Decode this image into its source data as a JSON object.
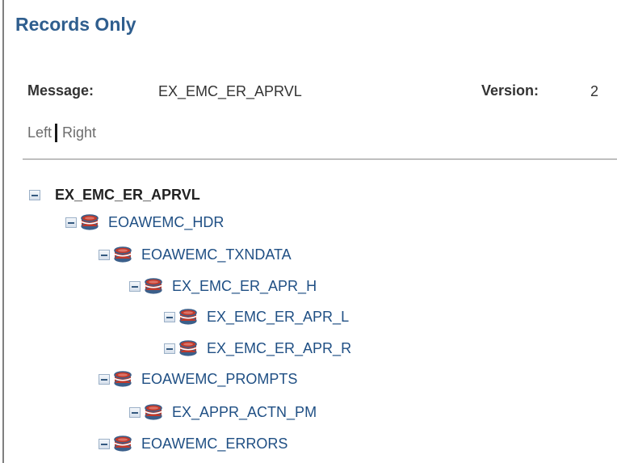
{
  "page": {
    "title": "Records Only"
  },
  "message": {
    "label": "Message:",
    "value": "EX_EMC_ER_APRVL"
  },
  "version": {
    "label": "Version:",
    "value": "2"
  },
  "view_links": {
    "left": "Left",
    "right": "Right"
  },
  "tree": {
    "root": "EX_EMC_ER_APRVL",
    "records": [
      "EOAWEMC_HDR",
      "EOAWEMC_TXNDATA",
      "EX_EMC_ER_APR_H",
      "EX_EMC_ER_APR_L",
      "EX_EMC_ER_APR_R",
      "EOAWEMC_PROMPTS",
      "EX_APPR_ACTN_PM",
      "EOAWEMC_ERRORS"
    ]
  },
  "colors": {
    "title": "#2f5e8e",
    "record_link": "#1f4f84",
    "db_icon_red": "#c0392b",
    "db_icon_blue": "#3b5f8a"
  }
}
